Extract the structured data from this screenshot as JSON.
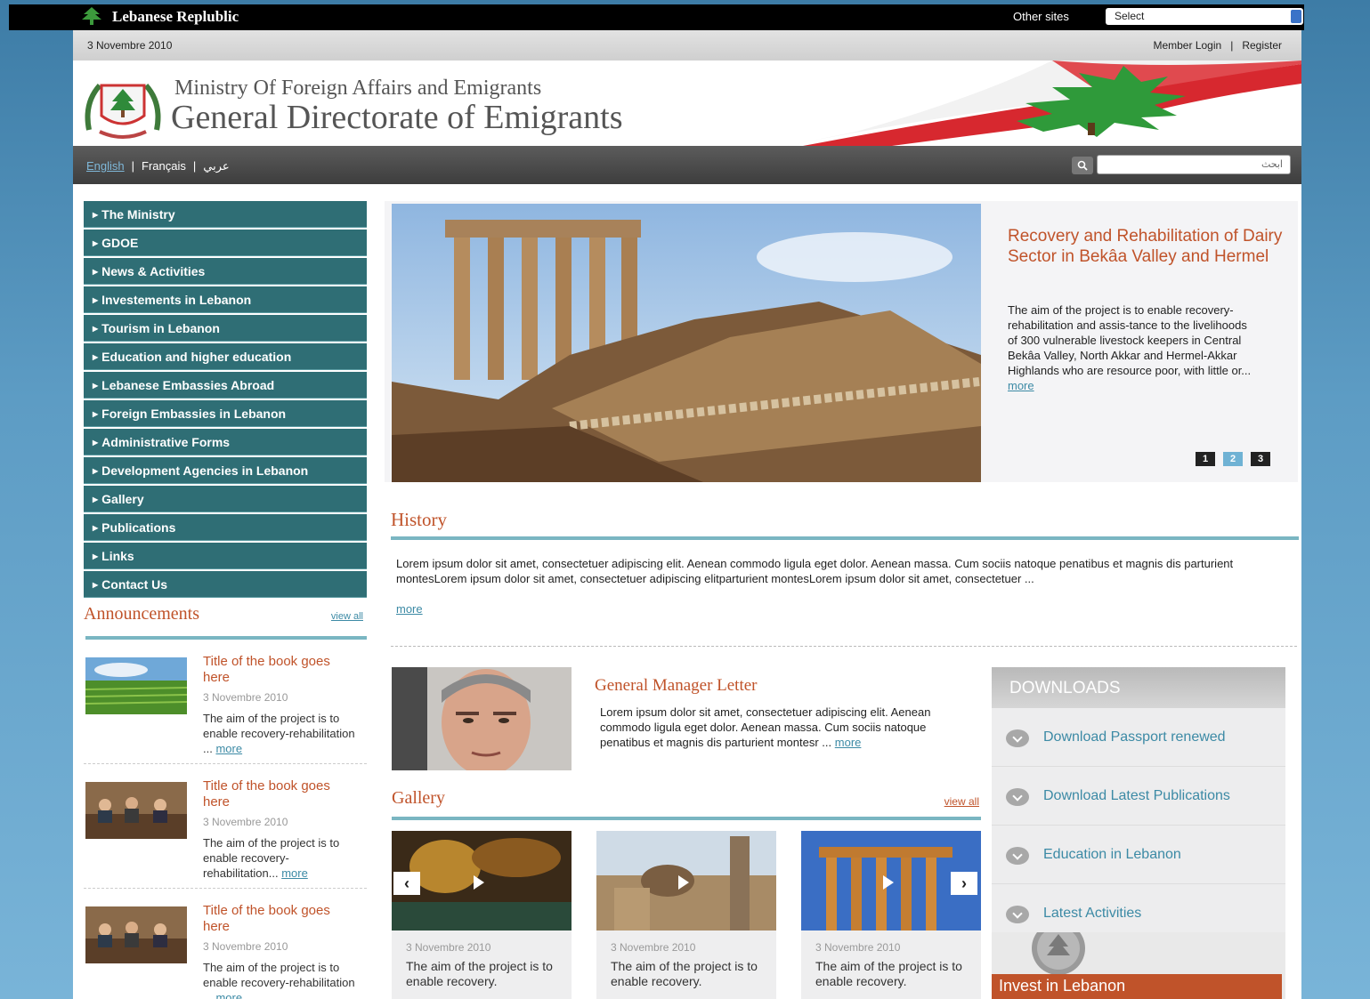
{
  "topbar": {
    "country": "Lebanese Replublic",
    "other_sites_label": "Other sites",
    "select_value": "Select"
  },
  "datebar": {
    "date": "3 Novembre 2010",
    "member_login": "Member Login",
    "register": "Register"
  },
  "header": {
    "ministry": "Ministry Of Foreign Affairs and Emigrants",
    "directorate": "General Directorate of Emigrants"
  },
  "langbar": {
    "english": "English",
    "french": "Français",
    "arabic": "عربي",
    "search_placeholder": "ابحث"
  },
  "nav": [
    "The Ministry",
    "GDOE",
    "News & Activities",
    "Investements in Lebanon",
    "Tourism in Lebanon",
    "Education and higher education",
    "Lebanese Embassies Abroad",
    "Foreign Embassies in Lebanon",
    "Administrative Forms",
    "Development Agencies in Lebanon",
    "Gallery",
    "Publications",
    "Links",
    "Contact Us"
  ],
  "announcements": {
    "title": "Announcements",
    "view_all": "view all",
    "items": [
      {
        "title": "Title of the book goes here",
        "date": "3 Novembre 2010",
        "desc": "The aim of the project is to enable recovery-rehabilitation ...",
        "more": "more"
      },
      {
        "title": "Title of the book goes here",
        "date": "3 Novembre 2010",
        "desc": "The aim of the project is to enable recovery-rehabilitation...",
        "more": "more"
      },
      {
        "title": "Title of the book goes here",
        "date": "3 Novembre 2010",
        "desc": "The aim of the project is to enable recovery-rehabilitation ...",
        "more": "more"
      }
    ]
  },
  "slider": {
    "title": "Recovery and Rehabilitation of Dairy Sector in Bekâa Valley and Hermel",
    "desc": "The aim of the project is to enable recovery-rehabilitation and assis-tance to the livelihoods of 300 vulnerable livestock keepers in Central Bekâa Valley, North Akkar and Hermel-Akkar Highlands who are resource poor, with little or...",
    "more": "more",
    "pages": [
      "1",
      "2",
      "3"
    ],
    "current_page": "2"
  },
  "history": {
    "title": "History",
    "text": "Lorem ipsum dolor sit amet, consectetuer adipiscing elit. Aenean commodo ligula eget dolor. Aenean massa. Cum sociis natoque penatibus et magnis dis parturient montesLorem ipsum dolor sit amet, consectetuer adipiscing elitparturient montesLorem ipsum dolor sit amet, consectetuer ...",
    "more": "more"
  },
  "gm_letter": {
    "title": "General Manager Letter",
    "text": "Lorem ipsum dolor sit amet, consectetuer adipiscing elit. Aenean commodo ligula eget dolor. Aenean massa. Cum sociis natoque penatibus et magnis dis parturient montesr ...",
    "more": "more"
  },
  "gallery": {
    "title": "Gallery",
    "view_all": "view all",
    "items": [
      {
        "date": "3 Novembre 2010",
        "desc": "The aim of the project is to enable recovery."
      },
      {
        "date": "3 Novembre 2010",
        "desc": "The aim of the project is to enable recovery."
      },
      {
        "date": "3 Novembre 2010",
        "desc": "The aim of the project is to enable recovery."
      }
    ]
  },
  "downloads": {
    "title": "DOWNLOADS",
    "items": [
      "Download Passport renewed",
      "Download Latest Publications",
      "Education in Lebanon",
      "Latest Activities"
    ],
    "invest": "Invest in Lebanon"
  },
  "colors": {
    "nav_bg": "#2f6e75",
    "accent": "#c0532a",
    "link": "#3c8aa5",
    "rule": "#7ab6c2"
  }
}
